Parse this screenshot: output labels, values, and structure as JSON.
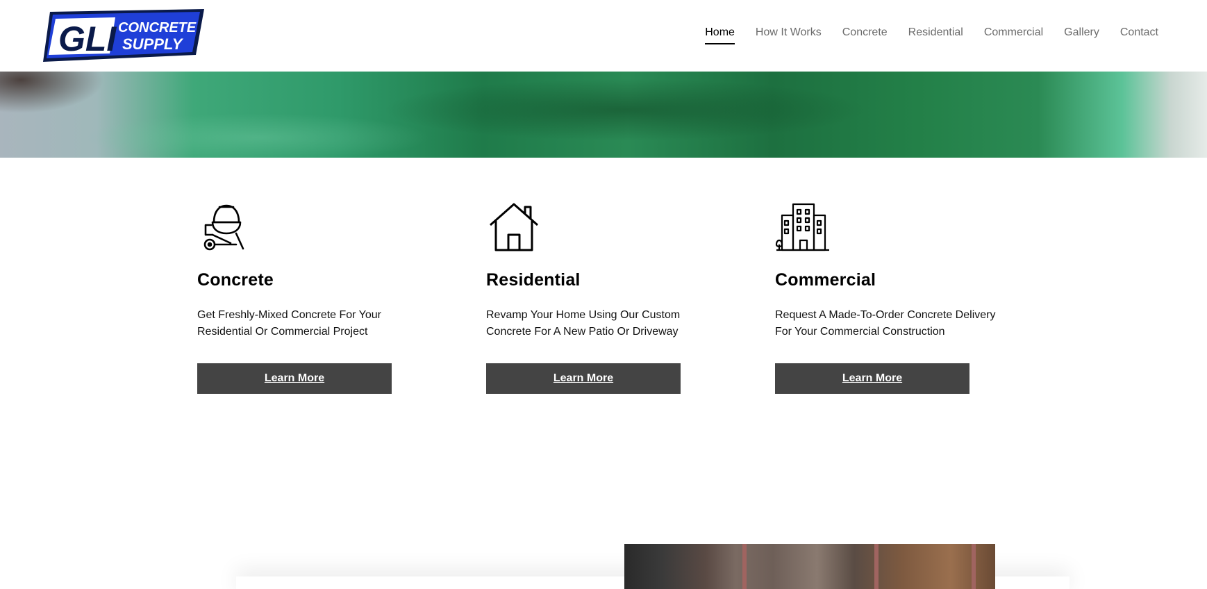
{
  "header": {
    "logo": {
      "icon": "gli-concrete-supply-logo",
      "line1": "GLI",
      "line2": "CONCRETE",
      "line3": "SUPPLY"
    },
    "nav": [
      {
        "label": "Home",
        "active": true
      },
      {
        "label": "How It Works",
        "active": false
      },
      {
        "label": "Concrete",
        "active": false
      },
      {
        "label": "Residential",
        "active": false
      },
      {
        "label": "Commercial",
        "active": false
      },
      {
        "label": "Gallery",
        "active": false
      },
      {
        "label": "Contact",
        "active": false
      }
    ]
  },
  "features": [
    {
      "icon": "cement-mixer-icon",
      "title": "Concrete",
      "description": "Get Freshly-Mixed Concrete For Your Residential Or Commercial Project",
      "button": "Learn More"
    },
    {
      "icon": "house-icon",
      "title": "Residential",
      "description": "Revamp Your Home Using Our Custom Concrete For A New Patio Or Driveway",
      "button": "Learn More"
    },
    {
      "icon": "office-building-icon",
      "title": "Commercial",
      "description": "Request A Made-To-Order Concrete Delivery For Your Commercial Construction",
      "button": "Learn More"
    }
  ],
  "colors": {
    "button_bg": "#444444",
    "logo_blue": "#1f3fd8",
    "hero_green": "#2a8a55"
  }
}
